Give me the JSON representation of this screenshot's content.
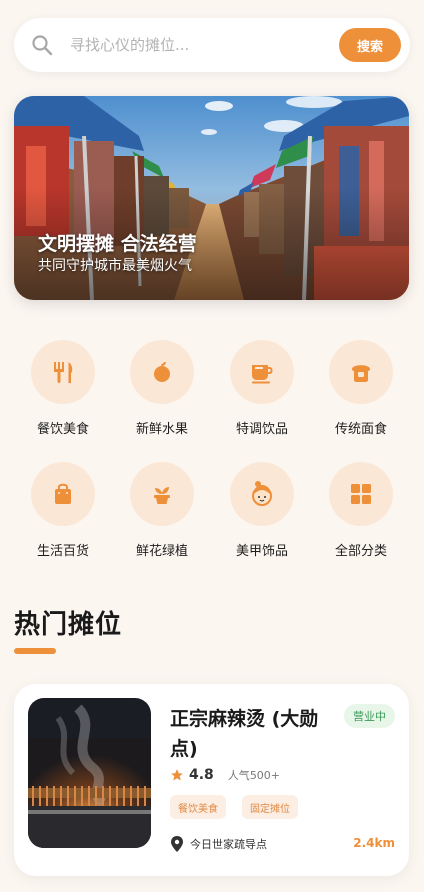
{
  "search": {
    "placeholder": "寻找心仪的摊位...",
    "button_label": "搜索",
    "icon": "search-icon"
  },
  "banner": {
    "title": "文明摆摊 合法经营",
    "subtitle": "共同守护城市最美烟火气"
  },
  "categories": [
    {
      "label": "餐饮美食",
      "icon": "fork-knife-icon"
    },
    {
      "label": "新鲜水果",
      "icon": "orange-icon"
    },
    {
      "label": "特调饮品",
      "icon": "coffee-cup-icon"
    },
    {
      "label": "传统面食",
      "icon": "bread-icon"
    },
    {
      "label": "生活百货",
      "icon": "shopping-bag-icon"
    },
    {
      "label": "鲜花绿植",
      "icon": "potted-plant-icon"
    },
    {
      "label": "美甲饰品",
      "icon": "girl-face-icon"
    },
    {
      "label": "全部分类",
      "icon": "grid-icon"
    }
  ],
  "section": {
    "title": "热门摊位"
  },
  "stall": {
    "name": "正宗麻辣烫 (大勋点)",
    "status": "营业中",
    "rating": "4.8",
    "popularity_label": "人气",
    "popularity_value": "500+",
    "tags": [
      "餐饮美食",
      "固定摊位"
    ],
    "location": "今日世家疏导点",
    "distance": "2.4km"
  },
  "colors": {
    "accent": "#ee8f3a",
    "background": "#fcf6f1",
    "category_circle": "#fbe7d6",
    "status_text": "#3b9a55",
    "status_bg": "#e8f6ea"
  }
}
